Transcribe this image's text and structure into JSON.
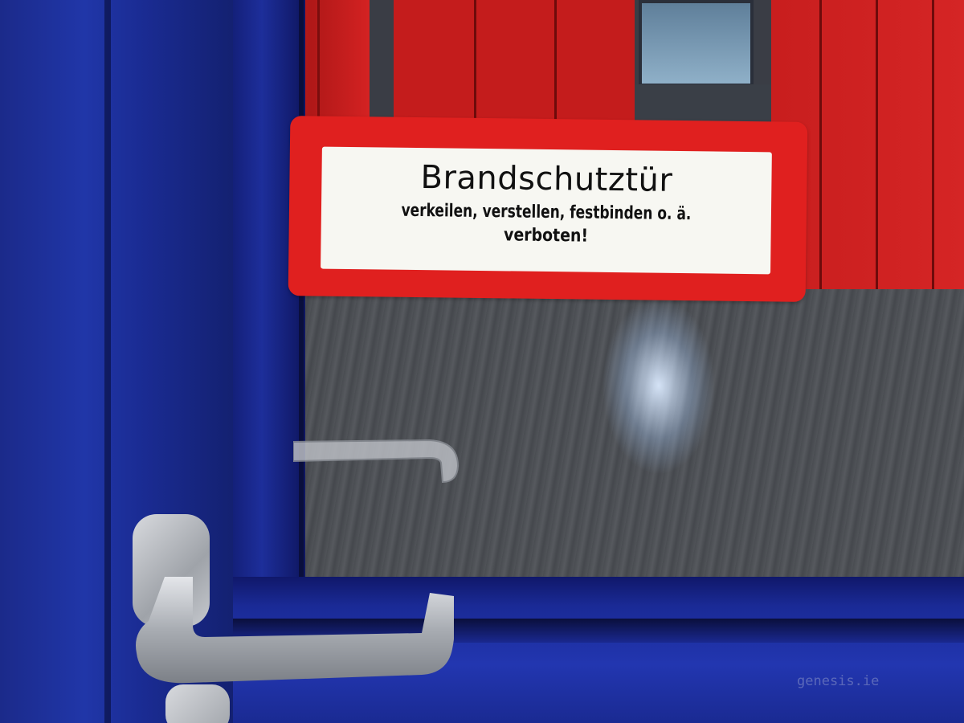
{
  "sign": {
    "title": "Brandschutztür",
    "line1": "verkeilen, verstellen, festbinden o. ä.",
    "line2": "verboten!"
  },
  "watermark": "genesis.ie",
  "colors": {
    "door_blue": "#2036a8",
    "sign_red": "#e0201f",
    "locker_red": "#c81e1e",
    "sign_background": "#f7f7f2"
  },
  "icons": {
    "door_handle": "door-handle-icon"
  }
}
